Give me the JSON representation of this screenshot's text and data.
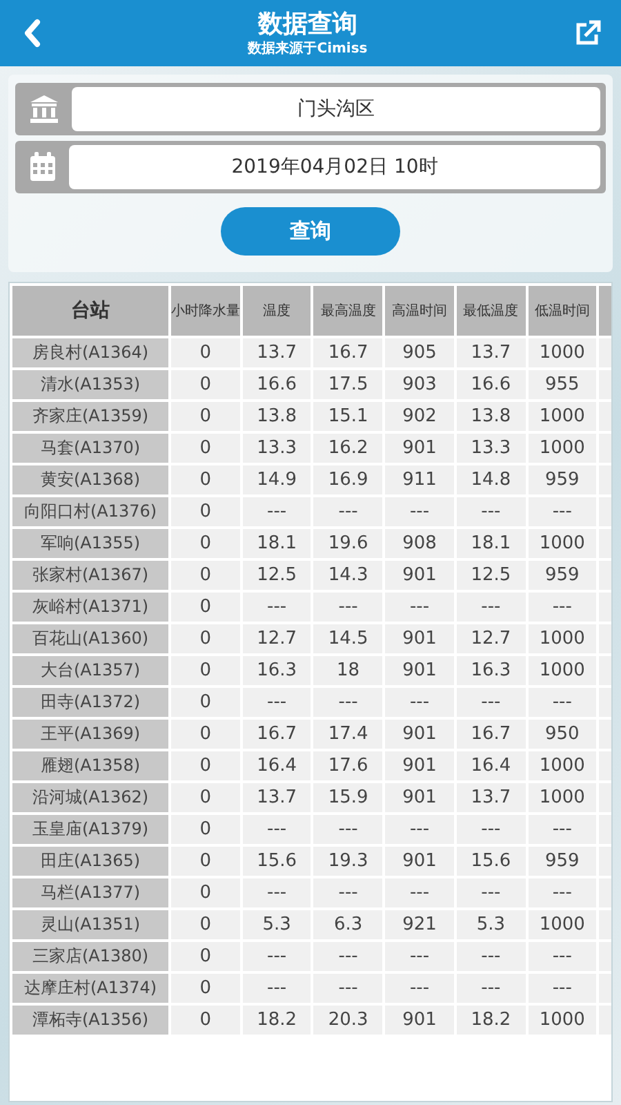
{
  "header": {
    "title": "数据查询",
    "subtitle": "数据来源于Cimiss"
  },
  "form": {
    "district": "门头沟区",
    "datetime": "2019年04月02日 10时",
    "submit": "查询"
  },
  "table": {
    "columns": [
      "台站",
      "小时降水量",
      "温度",
      "最高温度",
      "高温时间",
      "最低温度",
      "低温时间"
    ],
    "rows": [
      [
        "房良村(A1364)",
        "0",
        "13.7",
        "16.7",
        "905",
        "13.7",
        "1000"
      ],
      [
        "清水(A1353)",
        "0",
        "16.6",
        "17.5",
        "903",
        "16.6",
        "955"
      ],
      [
        "齐家庄(A1359)",
        "0",
        "13.8",
        "15.1",
        "902",
        "13.8",
        "1000"
      ],
      [
        "马套(A1370)",
        "0",
        "13.3",
        "16.2",
        "901",
        "13.3",
        "1000"
      ],
      [
        "黄安(A1368)",
        "0",
        "14.9",
        "16.9",
        "911",
        "14.8",
        "959"
      ],
      [
        "向阳口村(A1376)",
        "0",
        "---",
        "---",
        "---",
        "---",
        "---"
      ],
      [
        "军响(A1355)",
        "0",
        "18.1",
        "19.6",
        "908",
        "18.1",
        "1000"
      ],
      [
        "张家村(A1367)",
        "0",
        "12.5",
        "14.3",
        "901",
        "12.5",
        "959"
      ],
      [
        "灰峪村(A1371)",
        "0",
        "---",
        "---",
        "---",
        "---",
        "---"
      ],
      [
        "百花山(A1360)",
        "0",
        "12.7",
        "14.5",
        "901",
        "12.7",
        "1000"
      ],
      [
        "大台(A1357)",
        "0",
        "16.3",
        "18",
        "901",
        "16.3",
        "1000"
      ],
      [
        "田寺(A1372)",
        "0",
        "---",
        "---",
        "---",
        "---",
        "---"
      ],
      [
        "王平(A1369)",
        "0",
        "16.7",
        "17.4",
        "901",
        "16.7",
        "950"
      ],
      [
        "雁翅(A1358)",
        "0",
        "16.4",
        "17.6",
        "901",
        "16.4",
        "1000"
      ],
      [
        "沿河城(A1362)",
        "0",
        "13.7",
        "15.9",
        "901",
        "13.7",
        "1000"
      ],
      [
        "玉皇庙(A1379)",
        "0",
        "---",
        "---",
        "---",
        "---",
        "---"
      ],
      [
        "田庄(A1365)",
        "0",
        "15.6",
        "19.3",
        "901",
        "15.6",
        "959"
      ],
      [
        "马栏(A1377)",
        "0",
        "---",
        "---",
        "---",
        "---",
        "---"
      ],
      [
        "灵山(A1351)",
        "0",
        "5.3",
        "6.3",
        "921",
        "5.3",
        "1000"
      ],
      [
        "三家店(A1380)",
        "0",
        "---",
        "---",
        "---",
        "---",
        "---"
      ],
      [
        "达摩庄村(A1374)",
        "0",
        "---",
        "---",
        "---",
        "---",
        "---"
      ],
      [
        "潭柘寺(A1356)",
        "0",
        "18.2",
        "20.3",
        "901",
        "18.2",
        "1000"
      ]
    ]
  }
}
